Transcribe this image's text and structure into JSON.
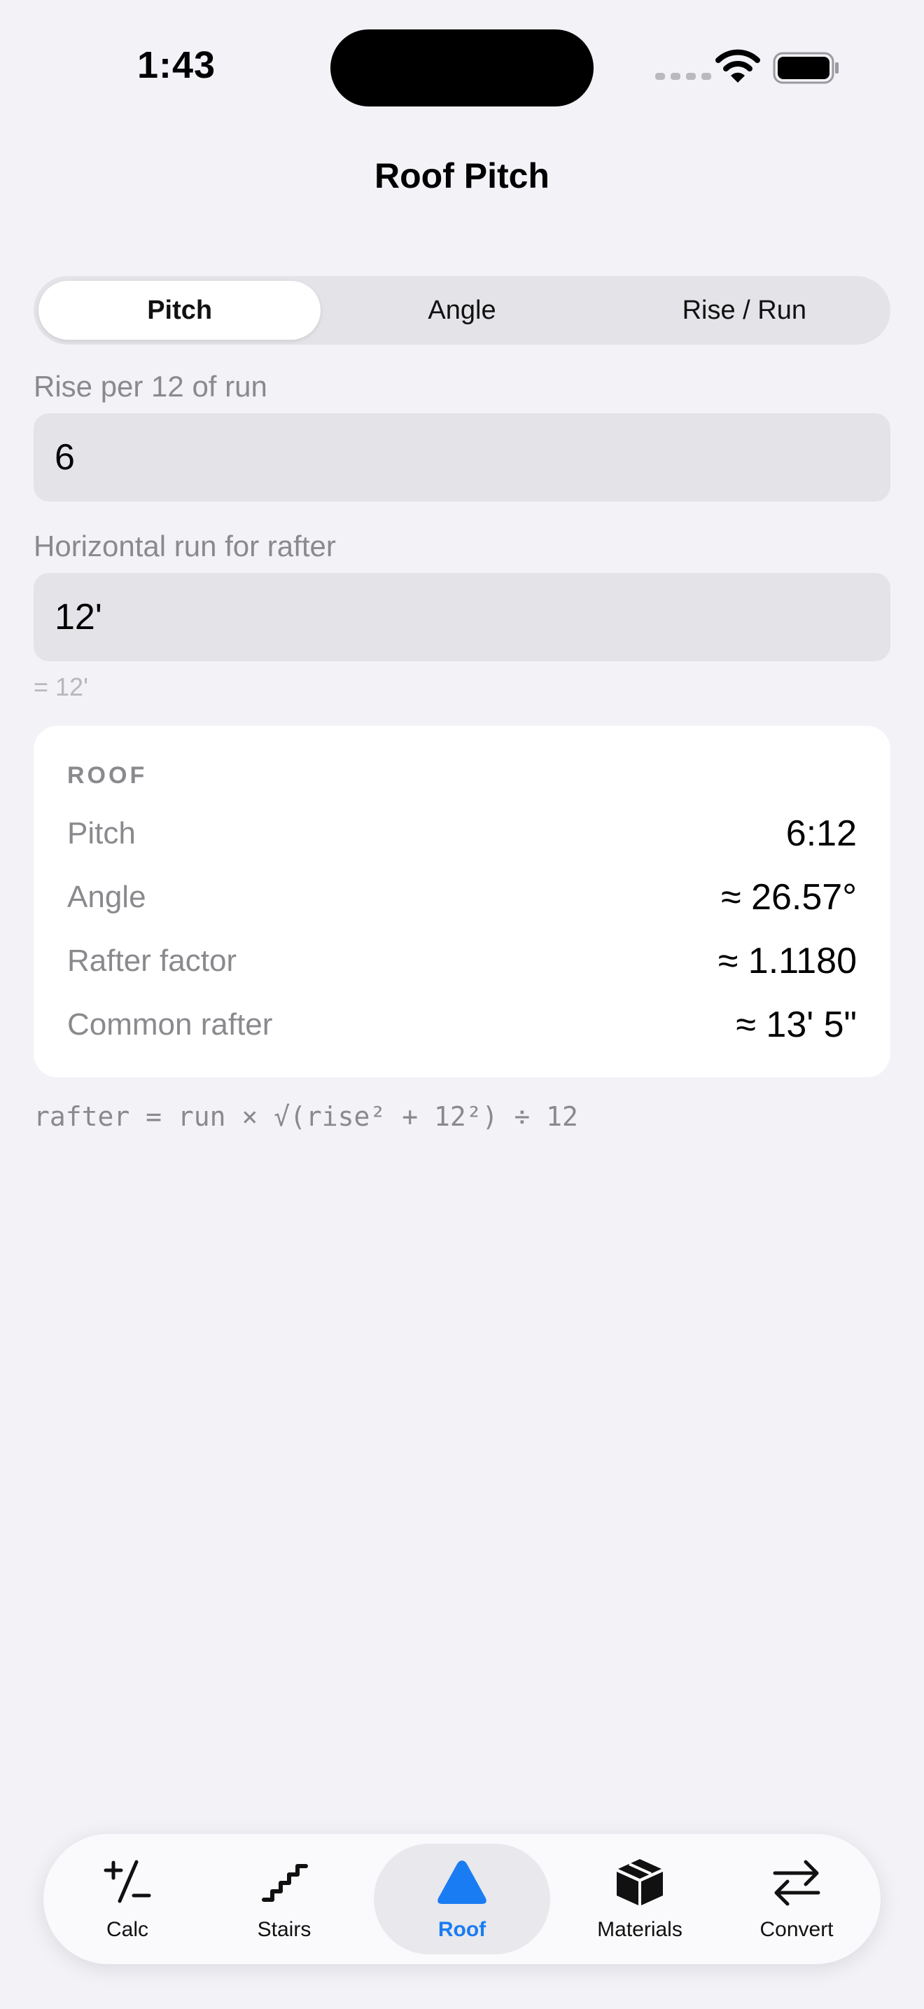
{
  "status": {
    "time": "1:43"
  },
  "nav": {
    "title": "Roof Pitch"
  },
  "segments": [
    {
      "label": "Pitch",
      "active": true
    },
    {
      "label": "Angle",
      "active": false
    },
    {
      "label": "Rise / Run",
      "active": false
    }
  ],
  "form": {
    "rise_label": "Rise per 12 of run",
    "rise_value": "6",
    "run_label": "Horizontal run for rafter",
    "run_value": "12'",
    "run_hint": "= 12'"
  },
  "results": {
    "header": "ROOF",
    "rows": [
      {
        "label": "Pitch",
        "value": "6:12"
      },
      {
        "label": "Angle",
        "value": "≈ 26.57°"
      },
      {
        "label": "Rafter factor",
        "value": "≈ 1.1180"
      },
      {
        "label": "Common rafter",
        "value": "≈ 13' 5\""
      }
    ]
  },
  "formula": "rafter = run × √(rise² + 12²) ÷ 12",
  "tabs": [
    {
      "label": "Calc",
      "icon": "plus-minus-icon"
    },
    {
      "label": "Stairs",
      "icon": "stairs-icon"
    },
    {
      "label": "Roof",
      "icon": "triangle-icon",
      "active": true
    },
    {
      "label": "Materials",
      "icon": "box-icon"
    },
    {
      "label": "Convert",
      "icon": "arrows-icon"
    }
  ],
  "colors": {
    "accent": "#1a7cf2",
    "background": "#f2f2f7",
    "secondary_text": "#8a8a8e"
  }
}
